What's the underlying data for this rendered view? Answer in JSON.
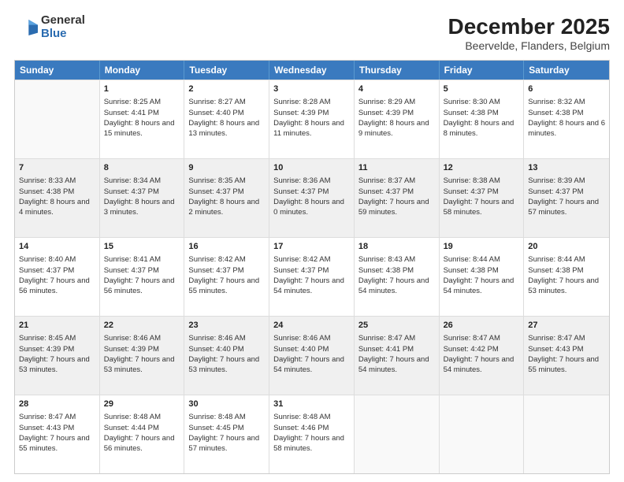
{
  "logo": {
    "general": "General",
    "blue": "Blue"
  },
  "title": "December 2025",
  "subtitle": "Beervelde, Flanders, Belgium",
  "days": [
    "Sunday",
    "Monday",
    "Tuesday",
    "Wednesday",
    "Thursday",
    "Friday",
    "Saturday"
  ],
  "weeks": [
    [
      {
        "day": "",
        "sunrise": "",
        "sunset": "",
        "daylight": "",
        "empty": true
      },
      {
        "day": "1",
        "sunrise": "Sunrise: 8:25 AM",
        "sunset": "Sunset: 4:41 PM",
        "daylight": "Daylight: 8 hours and 15 minutes."
      },
      {
        "day": "2",
        "sunrise": "Sunrise: 8:27 AM",
        "sunset": "Sunset: 4:40 PM",
        "daylight": "Daylight: 8 hours and 13 minutes."
      },
      {
        "day": "3",
        "sunrise": "Sunrise: 8:28 AM",
        "sunset": "Sunset: 4:39 PM",
        "daylight": "Daylight: 8 hours and 11 minutes."
      },
      {
        "day": "4",
        "sunrise": "Sunrise: 8:29 AM",
        "sunset": "Sunset: 4:39 PM",
        "daylight": "Daylight: 8 hours and 9 minutes."
      },
      {
        "day": "5",
        "sunrise": "Sunrise: 8:30 AM",
        "sunset": "Sunset: 4:38 PM",
        "daylight": "Daylight: 8 hours and 8 minutes."
      },
      {
        "day": "6",
        "sunrise": "Sunrise: 8:32 AM",
        "sunset": "Sunset: 4:38 PM",
        "daylight": "Daylight: 8 hours and 6 minutes."
      }
    ],
    [
      {
        "day": "7",
        "sunrise": "Sunrise: 8:33 AM",
        "sunset": "Sunset: 4:38 PM",
        "daylight": "Daylight: 8 hours and 4 minutes."
      },
      {
        "day": "8",
        "sunrise": "Sunrise: 8:34 AM",
        "sunset": "Sunset: 4:37 PM",
        "daylight": "Daylight: 8 hours and 3 minutes."
      },
      {
        "day": "9",
        "sunrise": "Sunrise: 8:35 AM",
        "sunset": "Sunset: 4:37 PM",
        "daylight": "Daylight: 8 hours and 2 minutes."
      },
      {
        "day": "10",
        "sunrise": "Sunrise: 8:36 AM",
        "sunset": "Sunset: 4:37 PM",
        "daylight": "Daylight: 8 hours and 0 minutes."
      },
      {
        "day": "11",
        "sunrise": "Sunrise: 8:37 AM",
        "sunset": "Sunset: 4:37 PM",
        "daylight": "Daylight: 7 hours and 59 minutes."
      },
      {
        "day": "12",
        "sunrise": "Sunrise: 8:38 AM",
        "sunset": "Sunset: 4:37 PM",
        "daylight": "Daylight: 7 hours and 58 minutes."
      },
      {
        "day": "13",
        "sunrise": "Sunrise: 8:39 AM",
        "sunset": "Sunset: 4:37 PM",
        "daylight": "Daylight: 7 hours and 57 minutes."
      }
    ],
    [
      {
        "day": "14",
        "sunrise": "Sunrise: 8:40 AM",
        "sunset": "Sunset: 4:37 PM",
        "daylight": "Daylight: 7 hours and 56 minutes."
      },
      {
        "day": "15",
        "sunrise": "Sunrise: 8:41 AM",
        "sunset": "Sunset: 4:37 PM",
        "daylight": "Daylight: 7 hours and 56 minutes."
      },
      {
        "day": "16",
        "sunrise": "Sunrise: 8:42 AM",
        "sunset": "Sunset: 4:37 PM",
        "daylight": "Daylight: 7 hours and 55 minutes."
      },
      {
        "day": "17",
        "sunrise": "Sunrise: 8:42 AM",
        "sunset": "Sunset: 4:37 PM",
        "daylight": "Daylight: 7 hours and 54 minutes."
      },
      {
        "day": "18",
        "sunrise": "Sunrise: 8:43 AM",
        "sunset": "Sunset: 4:38 PM",
        "daylight": "Daylight: 7 hours and 54 minutes."
      },
      {
        "day": "19",
        "sunrise": "Sunrise: 8:44 AM",
        "sunset": "Sunset: 4:38 PM",
        "daylight": "Daylight: 7 hours and 54 minutes."
      },
      {
        "day": "20",
        "sunrise": "Sunrise: 8:44 AM",
        "sunset": "Sunset: 4:38 PM",
        "daylight": "Daylight: 7 hours and 53 minutes."
      }
    ],
    [
      {
        "day": "21",
        "sunrise": "Sunrise: 8:45 AM",
        "sunset": "Sunset: 4:39 PM",
        "daylight": "Daylight: 7 hours and 53 minutes."
      },
      {
        "day": "22",
        "sunrise": "Sunrise: 8:46 AM",
        "sunset": "Sunset: 4:39 PM",
        "daylight": "Daylight: 7 hours and 53 minutes."
      },
      {
        "day": "23",
        "sunrise": "Sunrise: 8:46 AM",
        "sunset": "Sunset: 4:40 PM",
        "daylight": "Daylight: 7 hours and 53 minutes."
      },
      {
        "day": "24",
        "sunrise": "Sunrise: 8:46 AM",
        "sunset": "Sunset: 4:40 PM",
        "daylight": "Daylight: 7 hours and 54 minutes."
      },
      {
        "day": "25",
        "sunrise": "Sunrise: 8:47 AM",
        "sunset": "Sunset: 4:41 PM",
        "daylight": "Daylight: 7 hours and 54 minutes."
      },
      {
        "day": "26",
        "sunrise": "Sunrise: 8:47 AM",
        "sunset": "Sunset: 4:42 PM",
        "daylight": "Daylight: 7 hours and 54 minutes."
      },
      {
        "day": "27",
        "sunrise": "Sunrise: 8:47 AM",
        "sunset": "Sunset: 4:43 PM",
        "daylight": "Daylight: 7 hours and 55 minutes."
      }
    ],
    [
      {
        "day": "28",
        "sunrise": "Sunrise: 8:47 AM",
        "sunset": "Sunset: 4:43 PM",
        "daylight": "Daylight: 7 hours and 55 minutes."
      },
      {
        "day": "29",
        "sunrise": "Sunrise: 8:48 AM",
        "sunset": "Sunset: 4:44 PM",
        "daylight": "Daylight: 7 hours and 56 minutes."
      },
      {
        "day": "30",
        "sunrise": "Sunrise: 8:48 AM",
        "sunset": "Sunset: 4:45 PM",
        "daylight": "Daylight: 7 hours and 57 minutes."
      },
      {
        "day": "31",
        "sunrise": "Sunrise: 8:48 AM",
        "sunset": "Sunset: 4:46 PM",
        "daylight": "Daylight: 7 hours and 58 minutes."
      },
      {
        "day": "",
        "sunrise": "",
        "sunset": "",
        "daylight": "",
        "empty": true
      },
      {
        "day": "",
        "sunrise": "",
        "sunset": "",
        "daylight": "",
        "empty": true
      },
      {
        "day": "",
        "sunrise": "",
        "sunset": "",
        "daylight": "",
        "empty": true
      }
    ]
  ]
}
